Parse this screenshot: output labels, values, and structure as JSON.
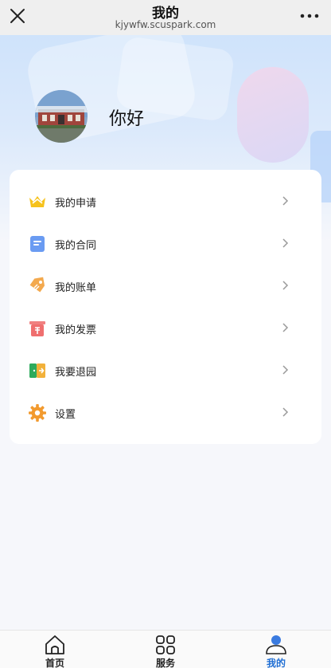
{
  "nav": {
    "title": "我的",
    "url": "kjywfw.scuspark.com"
  },
  "profile": {
    "greeting": "你好"
  },
  "menu": [
    {
      "label": "我的申请",
      "icon": "crown-icon",
      "color": "#f4b400"
    },
    {
      "label": "我的合同",
      "icon": "document-icon",
      "color": "#5b8ff0"
    },
    {
      "label": "我的账单",
      "icon": "tag-icon",
      "color": "#f2a54a"
    },
    {
      "label": "我的发票",
      "icon": "invoice-icon",
      "color": "#ef6f6f"
    },
    {
      "label": "我要退园",
      "icon": "exit-door-icon",
      "color": "#2eaa5c"
    },
    {
      "label": "设置",
      "icon": "gear-icon",
      "color": "#f29a2e"
    }
  ],
  "tabs": [
    {
      "label": "首页",
      "icon": "home-icon"
    },
    {
      "label": "服务",
      "icon": "grid-icon"
    },
    {
      "label": "我的",
      "icon": "user-icon",
      "active": true
    }
  ],
  "colors": {
    "accent": "#1f6ed4"
  }
}
